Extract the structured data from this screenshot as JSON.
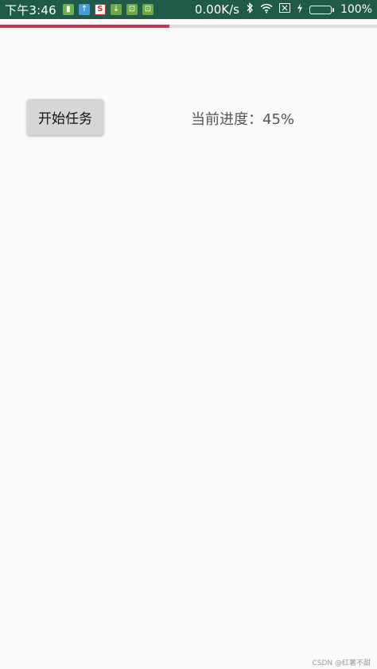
{
  "status_bar": {
    "time": "下午3:46",
    "network_speed": "0.00K/s",
    "battery_percent_label": "100%",
    "battery_level": 1.0,
    "notification_icons": [
      "sim-card-icon",
      "upload-icon",
      "weibo-icon",
      "download-icon",
      "android-icon",
      "android-icon"
    ]
  },
  "progress": {
    "value_percent": 45,
    "fill_color": "#c8335c",
    "track_color": "#dddddd"
  },
  "main": {
    "start_button_label": "开始任务",
    "progress_text": "当前进度：45%"
  },
  "watermark": "CSDN @红薯不甜"
}
